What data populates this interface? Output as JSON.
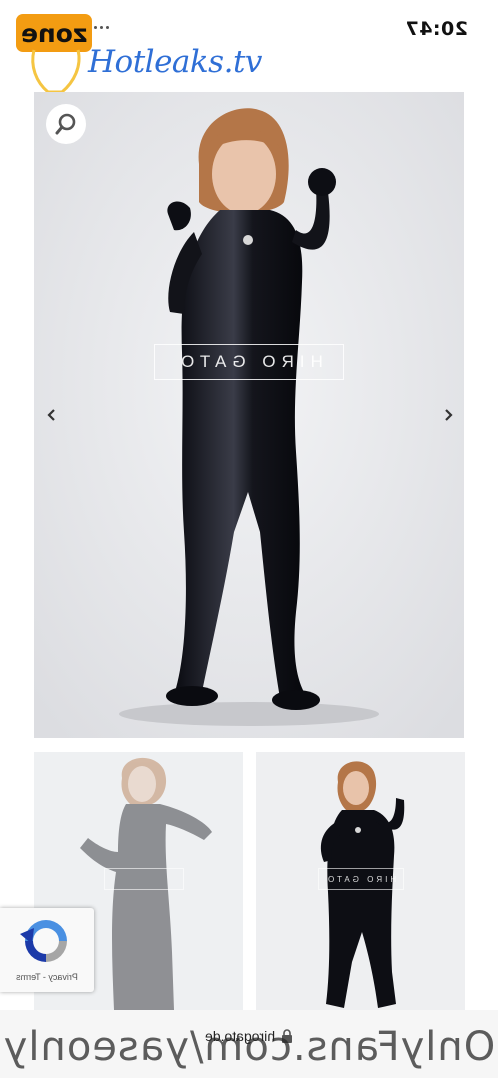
{
  "status_bar": {
    "time": "20:47"
  },
  "watermark": {
    "zone_label": "zone",
    "site_label": "Hotleaks.tv",
    "footer_text": "OnlyFans.com/yaseonly",
    "brand_color": "#f39c12",
    "site_color": "#2f6fd6"
  },
  "gallery": {
    "main_photo_overlay": "HIRO GATO",
    "thumb_overlay": "HIRO GATO",
    "zoom_icon": "magnifier-icon",
    "prev_icon": "chevron-left-icon",
    "next_icon": "chevron-right-icon"
  },
  "recaptcha": {
    "links": "Privacy - Terms"
  },
  "browser": {
    "url": "hirogato.de"
  }
}
